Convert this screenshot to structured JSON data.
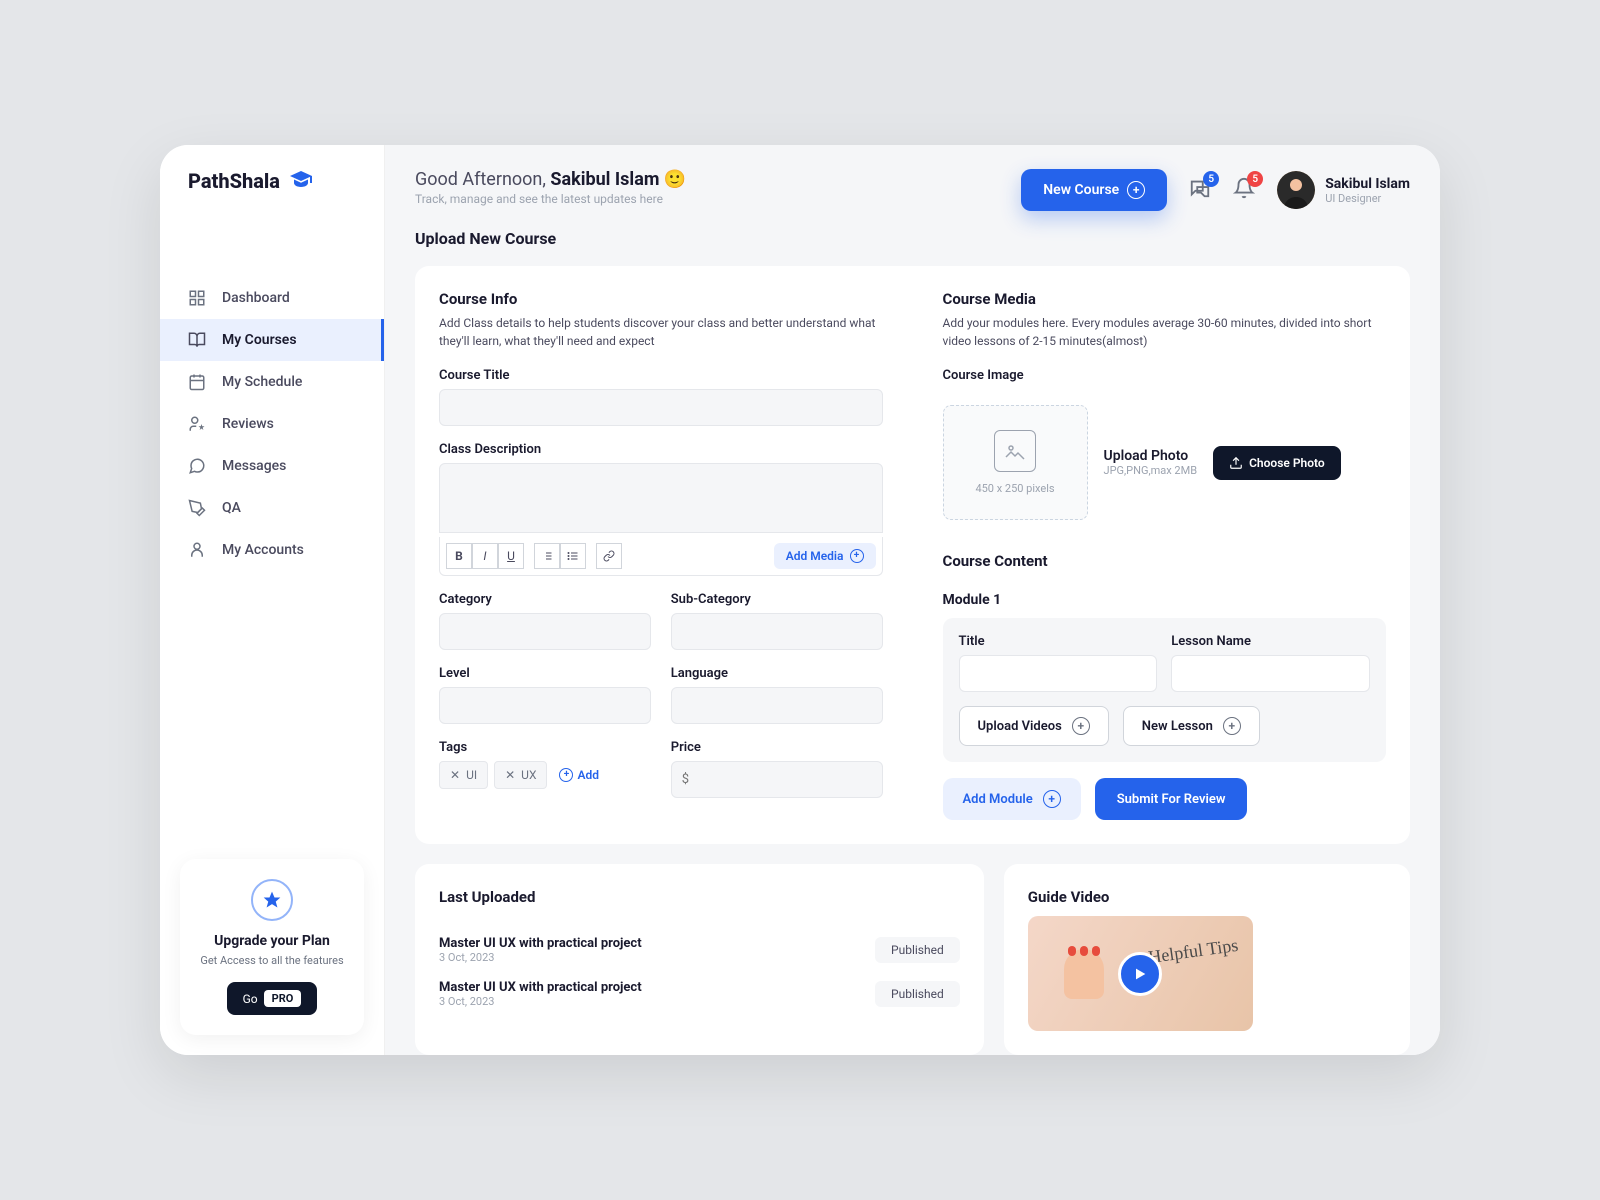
{
  "logo": "PathShala",
  "nav": {
    "dashboard": "Dashboard",
    "courses": "My Courses",
    "schedule": "My Schedule",
    "reviews": "Reviews",
    "messages": "Messages",
    "qa": "QA",
    "accounts": "My Accounts"
  },
  "upgrade": {
    "title": "Upgrade your Plan",
    "sub": "Get Access to all the features",
    "btn": "Go",
    "badge": "PRO"
  },
  "header": {
    "greeting_pre": "Good Afternoon, ",
    "greeting_name": "Sakibul Islam",
    "emoji": "🙂",
    "sub": "Track, manage and see the latest updates here",
    "new_course": "New Course",
    "msg_badge": "5",
    "bell_badge": "5",
    "user_name": "Sakibul Islam",
    "user_role": "UI Designer"
  },
  "page_title": "Upload New Course",
  "info": {
    "title": "Course Info",
    "desc": "Add Class details to help students discover your class and better understand what they'll learn, what they'll need and expect",
    "course_title": "Course Title",
    "class_desc": "Class Description",
    "add_media": "Add Media",
    "category": "Category",
    "sub_category": "Sub-Category",
    "level": "Level",
    "language": "Language",
    "tags_label": "Tags",
    "tag1": "UI",
    "tag2": "UX",
    "tag_add": "Add",
    "price": "Price",
    "price_placeholder": "$"
  },
  "media": {
    "title": "Course Media",
    "desc": "Add your modules here. Every modules average 30-60 minutes, divided into short video lessons of 2-15 minutes(almost)",
    "image_label": "Course Image",
    "dim": "450 x 250 pixels",
    "upload_title": "Upload Photo",
    "upload_sub": "JPG,PNG,max 2MB",
    "choose": "Choose Photo",
    "content_title": "Course  Content",
    "module_title": "Module 1",
    "title_label": "Title",
    "lesson_label": "Lesson Name",
    "upload_videos": "Upload Videos",
    "new_lesson": "New Lesson",
    "add_module": "Add Module",
    "submit": "Submit For Review"
  },
  "last": {
    "title": "Last Uploaded",
    "items": [
      {
        "title": "Master UI UX  with practical project",
        "date": "3 Oct, 2023",
        "status": "Published"
      },
      {
        "title": "Master UI UX  with practical project",
        "date": "3 Oct, 2023",
        "status": "Published"
      }
    ]
  },
  "guide": {
    "title": "Guide Video",
    "thumb_text": "Helpful Tips"
  }
}
